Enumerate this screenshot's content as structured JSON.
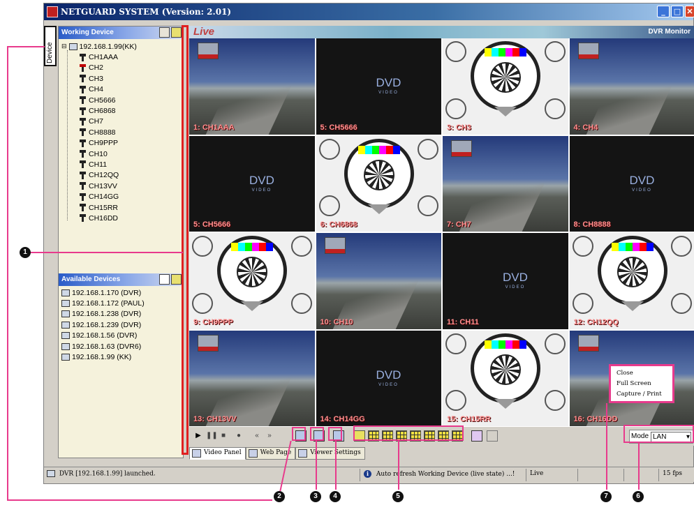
{
  "window": {
    "title": "NETGUARD SYSTEM (Version: 2.01)",
    "controls": {
      "min": "_",
      "max": "□",
      "close": "✕"
    }
  },
  "side_tab": {
    "label": "Device"
  },
  "working_device": {
    "header": "Working Device",
    "root": "192.168.1.99(KK)",
    "channels": [
      {
        "label": "CH1AAA",
        "status": "ok"
      },
      {
        "label": "CH2",
        "status": "error"
      },
      {
        "label": "CH3",
        "status": "ok"
      },
      {
        "label": "CH4",
        "status": "ok"
      },
      {
        "label": "CH5666",
        "status": "ok"
      },
      {
        "label": "CH6868",
        "status": "ok"
      },
      {
        "label": "CH7",
        "status": "ok"
      },
      {
        "label": "CH8888",
        "status": "ok"
      },
      {
        "label": "CH9PPP",
        "status": "ok"
      },
      {
        "label": "CH10",
        "status": "ok"
      },
      {
        "label": "CH11",
        "status": "ok"
      },
      {
        "label": "CH12QQ",
        "status": "ok"
      },
      {
        "label": "CH13VV",
        "status": "ok"
      },
      {
        "label": "CH14GG",
        "status": "ok"
      },
      {
        "label": "CH15RR",
        "status": "ok"
      },
      {
        "label": "CH16DD",
        "status": "ok"
      }
    ]
  },
  "available_devices": {
    "header": "Available Devices",
    "items": [
      "192.168.1.170 (DVR)",
      "192.168.1.172 (PAUL)",
      "192.168.1.238 (DVR)",
      "192.168.1.239 (DVR)",
      "192.168.1.56 (DVR)",
      "192.168.1.63 (DVR6)",
      "192.168.1.99 (KK)"
    ]
  },
  "video": {
    "live_label": "Live",
    "monitor_label": "DVR Monitor",
    "cells": [
      {
        "label": "1: CH1AAA",
        "type": "scene"
      },
      {
        "label": "5: CH5666",
        "type": "dvd"
      },
      {
        "label": "3: CH3",
        "type": "pattern"
      },
      {
        "label": "4: CH4",
        "type": "scene"
      },
      {
        "label": "5: CH5666",
        "type": "dvd"
      },
      {
        "label": "6: CH6868",
        "type": "pattern"
      },
      {
        "label": "7: CH7",
        "type": "scene"
      },
      {
        "label": "8: CH8888",
        "type": "dvd"
      },
      {
        "label": "9: CH9PPP",
        "type": "pattern"
      },
      {
        "label": "10: CH10",
        "type": "scene"
      },
      {
        "label": "11: CH11",
        "type": "dvd"
      },
      {
        "label": "12: CH12QQ",
        "type": "pattern"
      },
      {
        "label": "13: CH13VV",
        "type": "scene"
      },
      {
        "label": "14: CH14GG",
        "type": "dvd"
      },
      {
        "label": "15: CH15RR",
        "type": "pattern"
      },
      {
        "label": "16: CH16DD",
        "type": "scene"
      }
    ],
    "dvd_text": "DVD",
    "dvd_sub": "VIDEO"
  },
  "context_menu": {
    "items": [
      "Close",
      "Full Screen",
      "Capture / Print"
    ]
  },
  "toolbar": {
    "mode_label": "Mode",
    "mode_value": "LAN"
  },
  "tabs": [
    "Video Panel",
    "Web Page",
    "Viewer Settings"
  ],
  "status": {
    "left": "DVR [192.168.1.99] launched.",
    "message": "Auto refresh Working Device (live state) ...!",
    "state": "Live",
    "fps": "15 fps"
  },
  "callouts": [
    "1",
    "2",
    "3",
    "4",
    "5",
    "7",
    "6"
  ],
  "colors": {
    "annotation": "#e83a8c",
    "highlight": "#e02020",
    "panel_bg": "#f5f2dc"
  }
}
